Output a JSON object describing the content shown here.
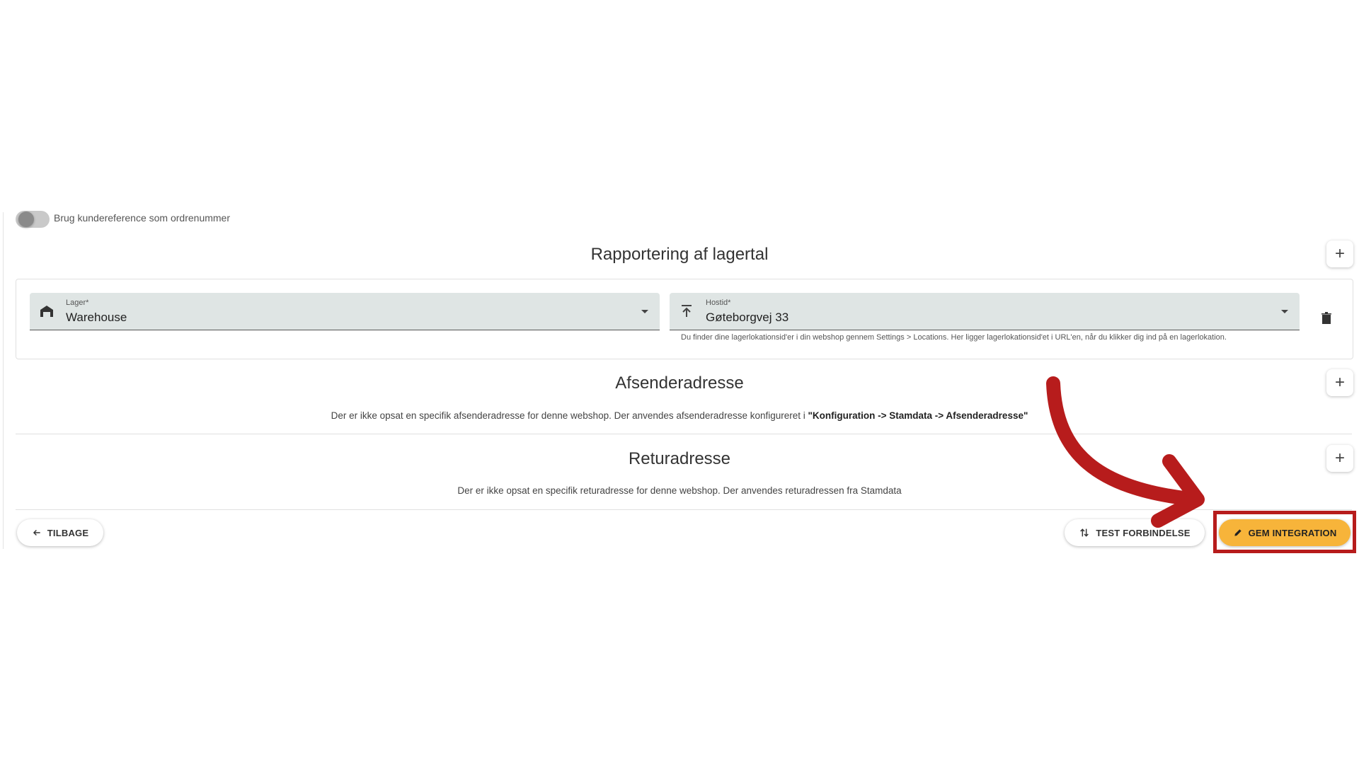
{
  "toggle": {
    "label": "Brug kundereference som ordrenummer",
    "enabled": false
  },
  "stock_reporting": {
    "title": "Rapportering af lagertal",
    "add_icon": "plus-icon",
    "warehouse_field": {
      "label": "Lager*",
      "value": "Warehouse",
      "icon": "warehouse-icon"
    },
    "location_field": {
      "label": "Hostid*",
      "value": "Gøteborgvej 33",
      "icon": "upload-icon"
    },
    "hint": "Du finder dine lagerlokationsid'er i din webshop gennem Settings > Locations. Her ligger lagerlokationsid'et i URL'en, når du klikker dig ind på en lagerlokation.",
    "delete_icon": "trash-icon"
  },
  "sender_address": {
    "title": "Afsenderadresse",
    "text_prefix": "Der er ikke opsat en specifik afsenderadresse for denne webshop. Der anvendes afsenderadresse konfigureret i ",
    "text_path": "\"Konfiguration -> Stamdata -> Afsenderadresse\""
  },
  "return_address": {
    "title": "Returadresse",
    "text": "Der er ikke opsat en specifik returadresse for denne webshop. Der anvendes returadressen fra Stamdata"
  },
  "footer": {
    "back_label": "TILBAGE",
    "test_label": "TEST FORBINDELSE",
    "save_label": "GEM INTEGRATION"
  },
  "colors": {
    "save_button": "#f7b43a",
    "annotation": "#b71c1c",
    "field_bg": "#dfe5e4"
  }
}
